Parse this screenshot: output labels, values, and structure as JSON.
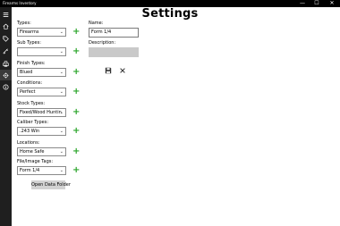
{
  "window": {
    "title": "Firearms Inventory",
    "controls": {
      "minimize": "—",
      "maximize": "☐",
      "close": "✕"
    }
  },
  "sidebar": {
    "items": [
      {
        "icon": "hamburger-menu-icon"
      },
      {
        "icon": "home-icon"
      },
      {
        "icon": "tag-icon"
      },
      {
        "icon": "rifle-icon"
      },
      {
        "icon": "print-icon"
      },
      {
        "icon": "gear-icon",
        "selected": true
      },
      {
        "icon": "info-icon"
      }
    ]
  },
  "page": {
    "title": "Settings"
  },
  "form": {
    "types_label": "Types:",
    "types_value": "Firearms",
    "subtypes_label": "Sub Types:",
    "subtypes_value": "",
    "finish_label": "Finish Types:",
    "finish_value": "Blued",
    "conditions_label": "Conditions:",
    "conditions_value": "Perfect",
    "stock_label": "Stock Types:",
    "stock_value": "Fixed/Wood Huntin",
    "caliber_label": "Caliber Types:",
    "caliber_value": ".243 Win",
    "locations_label": "Locations:",
    "locations_value": "Home Safe",
    "file_label": "File/Image Tags:",
    "file_value": "Form 1/4",
    "add_symbol": "+",
    "open_data_folder": "Open Data Folder"
  },
  "detail": {
    "name_label": "Name:",
    "name_value": "Form 1/4",
    "description_label": "Description:"
  },
  "colors": {
    "accent_green": "#2aa52a",
    "sidebar": "#1f1f1f",
    "titlebar": "#000000"
  }
}
